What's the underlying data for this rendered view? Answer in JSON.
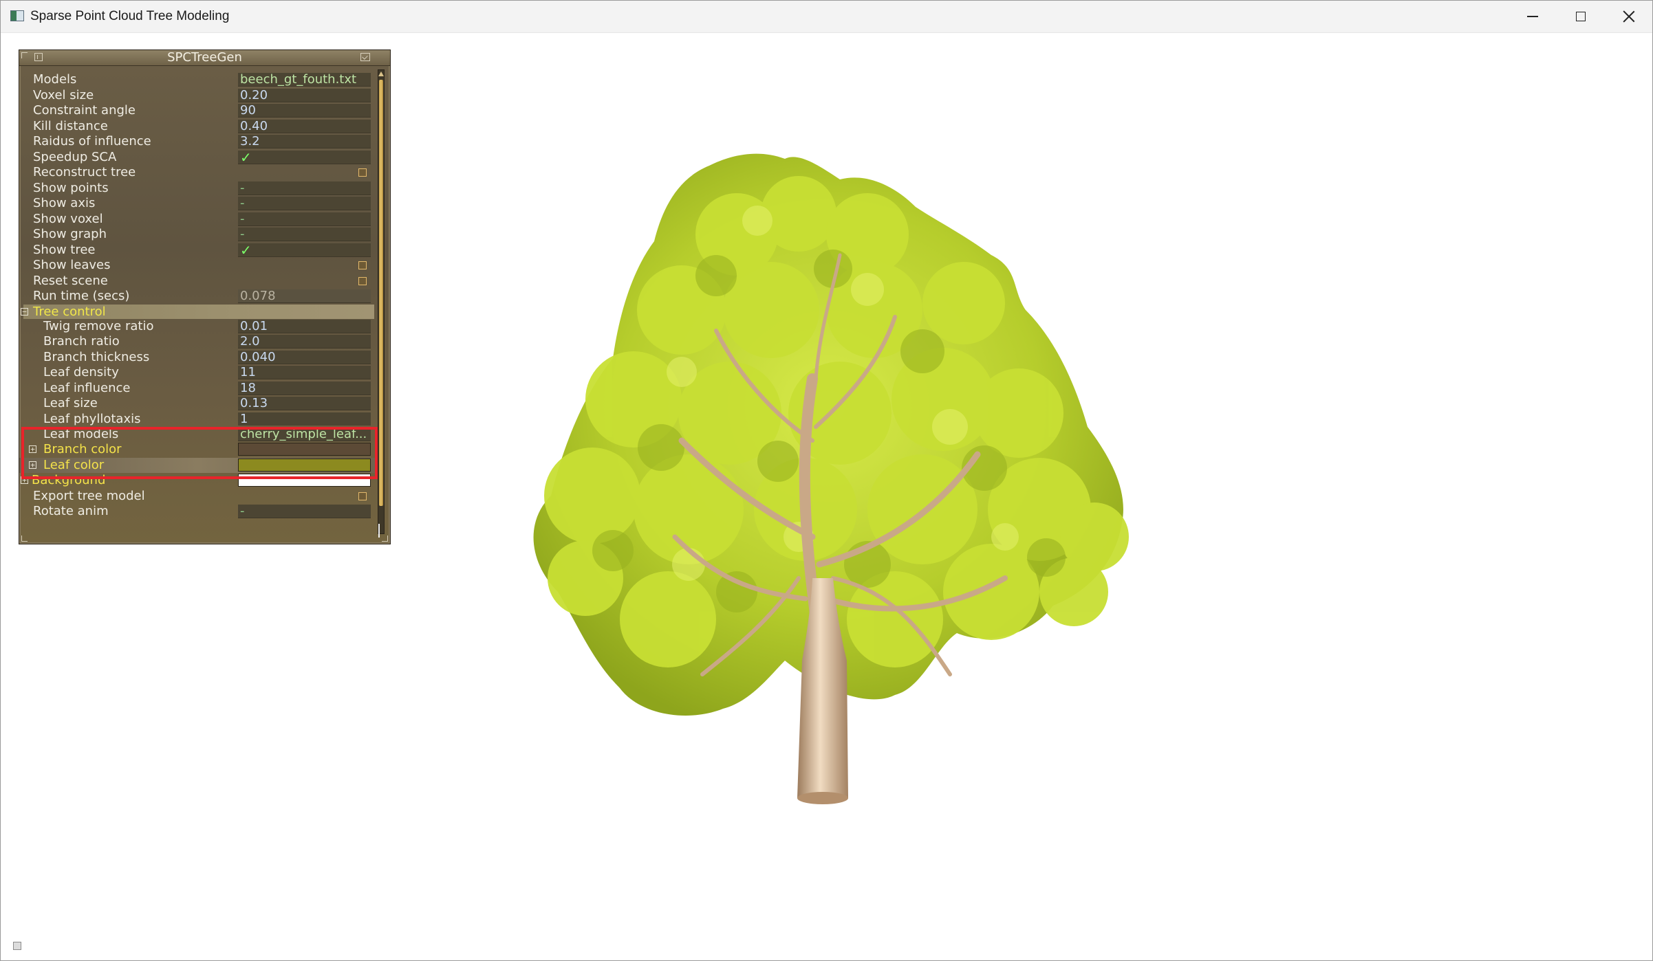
{
  "window": {
    "title": "Sparse Point Cloud Tree Modeling"
  },
  "panel": {
    "title": "SPCTreeGen",
    "rows": [
      {
        "label": "Models",
        "value": "beech_gt_fouth.txt"
      },
      {
        "label": "Voxel size",
        "value": "0.20"
      },
      {
        "label": "Constraint angle",
        "value": "90"
      },
      {
        "label": "Kill distance",
        "value": "0.40"
      },
      {
        "label": "Raidus of influence",
        "value": "3.2"
      },
      {
        "label": "Speedup SCA",
        "value": "✓"
      },
      {
        "label": "Reconstruct tree",
        "value": ""
      },
      {
        "label": "Show points",
        "value": "-"
      },
      {
        "label": "Show axis",
        "value": "-"
      },
      {
        "label": "Show voxel",
        "value": "-"
      },
      {
        "label": "Show graph",
        "value": "-"
      },
      {
        "label": "Show tree",
        "value": "✓"
      },
      {
        "label": "Show leaves",
        "value": ""
      },
      {
        "label": "Reset scene",
        "value": ""
      },
      {
        "label": "Run time (secs)",
        "value": "0.078"
      },
      {
        "label": "Tree control",
        "value": ""
      },
      {
        "label": "Twig remove ratio",
        "value": "0.01"
      },
      {
        "label": "Branch ratio",
        "value": "2.0"
      },
      {
        "label": "Branch thickness",
        "value": "0.040"
      },
      {
        "label": "Leaf density",
        "value": "11"
      },
      {
        "label": "Leaf influence",
        "value": "18"
      },
      {
        "label": "Leaf size",
        "value": "0.13"
      },
      {
        "label": "Leaf phyllotaxis",
        "value": "1"
      },
      {
        "label": "Leaf models",
        "value": "cherry_simple_leaf..."
      },
      {
        "label": "Branch color",
        "value": ""
      },
      {
        "label": "Leaf color",
        "value": ""
      },
      {
        "label": "Background",
        "value": ""
      },
      {
        "label": "Export tree model",
        "value": ""
      },
      {
        "label": "Rotate anim",
        "value": "-"
      }
    ],
    "collapse_symbol": "−",
    "expand_symbol": "+"
  },
  "colors": {
    "branch_color": "#5c4a36",
    "leaf_color": "#8c8a1f",
    "background_color": "#ffffff",
    "highlight": "#e8242a",
    "leaf_foliage": "#b5cf2a",
    "branch_wood": "#c9a887"
  },
  "icons": {
    "app": "app-icon",
    "minimize": "minimize-icon",
    "maximize": "maximize-icon",
    "close": "close-icon"
  }
}
